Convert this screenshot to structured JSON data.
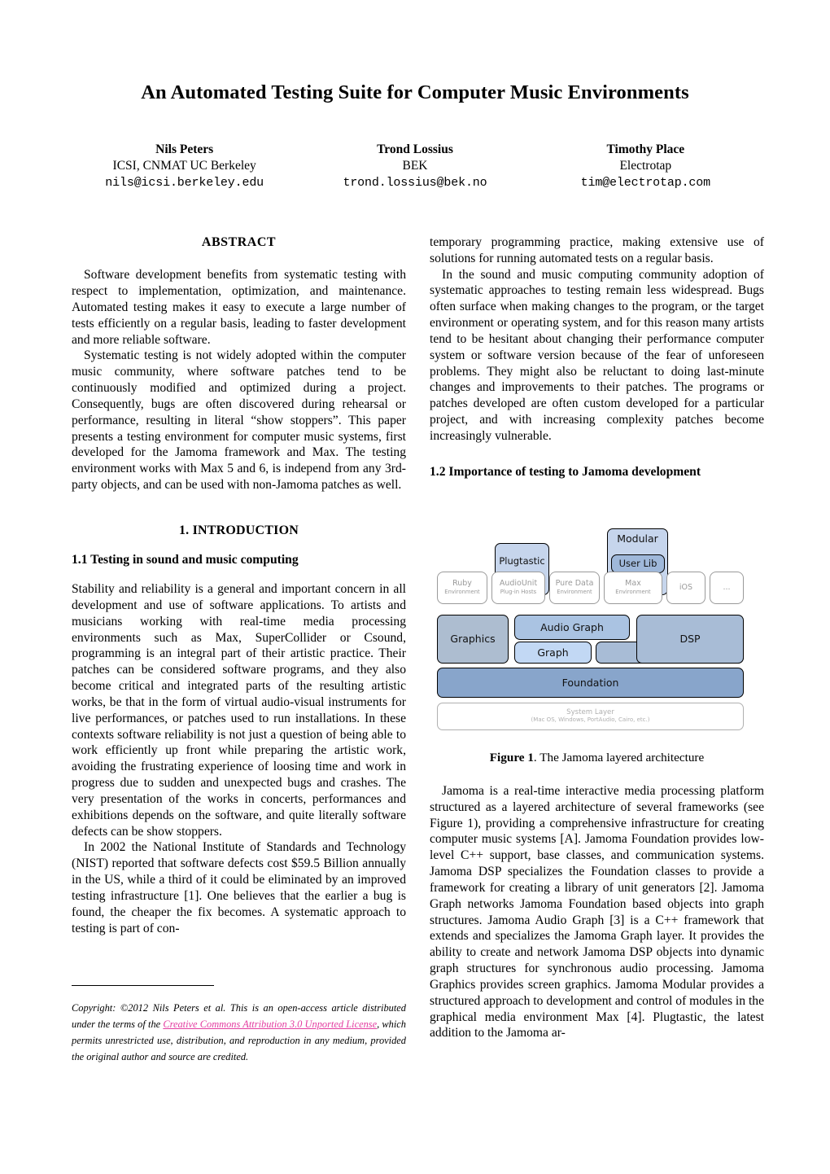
{
  "paper": {
    "title": "An Automated Testing Suite for Computer Music Environments",
    "authors": [
      {
        "name": "Nils Peters",
        "affiliation": "ICSI, CNMAT UC Berkeley",
        "email": "nils@icsi.berkeley.edu"
      },
      {
        "name": "Trond Lossius",
        "affiliation": "BEK",
        "email": "trond.lossius@bek.no"
      },
      {
        "name": "Timothy Place",
        "affiliation": "Electrotap",
        "email": "tim@electrotap.com"
      }
    ],
    "abstract": {
      "heading": "ABSTRACT",
      "paragraphs": [
        "Software development benefits from systematic testing with respect to implementation, optimization, and maintenance. Automated testing makes it easy to execute a large number of tests efficiently on a regular basis, leading to faster development and more reliable software.",
        "Systematic testing is not widely adopted within the computer music community, where software patches tend to be continuously modified and optimized during a project. Consequently, bugs are often discovered during rehearsal or performance, resulting in literal “show stoppers”. This paper presents a testing environment for computer music systems, first developed for the Jamoma framework and Max. The testing environment works with Max 5 and 6, is independ from any 3rd-party objects, and can be used with non-Jamoma patches as well."
      ]
    },
    "sections": {
      "intro_number_title": "1.  INTRODUCTION",
      "sub11": "1.1  Testing in sound and music computing",
      "sub11_paragraphs": [
        "Stability and reliability is a general and important concern in all development and use of software applications. To artists and musicians working with real-time media processing environments such as Max, SuperCollider or Csound, programming is an integral part of their artistic practice. Their patches can be considered software programs, and they also become critical and integrated parts of the resulting artistic works, be that in the form of virtual audio-visual instruments for live performances, or patches used to run installations. In these contexts software reliability is not just a question of being able to work efficiently up front while preparing the artistic work, avoiding the frustrating experience of loosing time and work in progress due to sudden and unexpected bugs and crashes. The very presentation of the works in concerts, performances and exhibitions depends on the software, and quite literally software defects can be show stoppers.",
        "In 2002 the National Institute of Standards and Technology (NIST) reported that software defects cost $59.5 Billion annually in the US, while a third of it could be eliminated by an improved testing infrastructure [1]. One believes that the earlier a bug is found, the cheaper the fix becomes. A systematic approach to testing is part of con-"
      ],
      "right_continuation": [
        "temporary programming practice, making extensive use of solutions for running automated tests on a regular basis.",
        "In the sound and music computing community adoption of systematic approaches to testing remain less widespread. Bugs often surface when making changes to the program, or the target environment or operating system, and for this reason many artists tend to be hesitant about changing their performance computer system or software version because of the fear of unforeseen problems. They might also be reluctant to doing last-minute changes and improvements to their patches. The programs or patches developed are often custom developed for a particular project, and with increasing complexity patches become increasingly vulnerable."
      ],
      "sub12": "1.2  Importance of testing to Jamoma development",
      "sub12_paragraphs": [
        "Jamoma is a real-time interactive media processing platform structured as a layered architecture of several frameworks (see Figure 1), providing a comprehensive infrastructure for creating computer music systems [A]. Jamoma Foundation provides low-level C++ support, base classes, and communication systems. Jamoma DSP specializes the Foundation classes to provide a framework for creating a library of unit generators [2]. Jamoma Graph networks Jamoma Foundation based objects into graph structures. Jamoma Audio Graph [3] is a C++ framework that extends and specializes the Jamoma Graph layer. It provides the ability to create and network Jamoma DSP objects into dynamic graph structures for synchronous audio processing. Jamoma Graphics provides screen graphics. Jamoma Modular provides a structured approach to development and control of modules in the graphical media environment Max [4]. Plugtastic, the latest addition to the Jamoma ar-"
      ]
    },
    "figure1": {
      "caption_label": "Figure 1",
      "caption_text": ". The Jamoma layered architecture",
      "environments": [
        {
          "main": "Ruby",
          "sub": "Environment"
        },
        {
          "main": "AudioUnit",
          "sub": "Plug-in Hosts"
        },
        {
          "main": "Pure Data",
          "sub": "Environment"
        },
        {
          "main": "Max",
          "sub": "Environment"
        },
        {
          "main": "iOS",
          "sub": ""
        },
        {
          "main": "...",
          "sub": ""
        }
      ],
      "plugtastic": "Plugtastic",
      "modular": "Modular",
      "user_lib": "User Lib",
      "graphics": "Graphics",
      "audio_graph": "Audio Graph",
      "graph": "Graph",
      "dsp": "DSP",
      "foundation": "Foundation",
      "system_layer_main": "System Layer",
      "system_layer_sub": "(Mac OS, Windows, PortAudio, Cairo, etc.)",
      "colors": {
        "plugtastic": "#c6d5ec",
        "modular": "#c6d5ec",
        "user_lib": "#9fb8da",
        "graphics": "#adbdd0",
        "audio_graph": "#aac3e2",
        "graph": "#c2d8f4",
        "dsp": "#a8bcd6",
        "foundation": "#88a5cb",
        "environment_border": "#9a9a9a"
      }
    },
    "copyright": {
      "prefix": "Copyright:  ©2012 Nils Peters  et al.  This is an open-access article distributed under the terms of the ",
      "link": "Creative Commons Attribution 3.0 Unported License",
      "suffix": ", which permits unrestricted use, distribution, and reproduction in any medium, provided the original author and source are credited.",
      "link_color": "#e33ca0"
    }
  }
}
